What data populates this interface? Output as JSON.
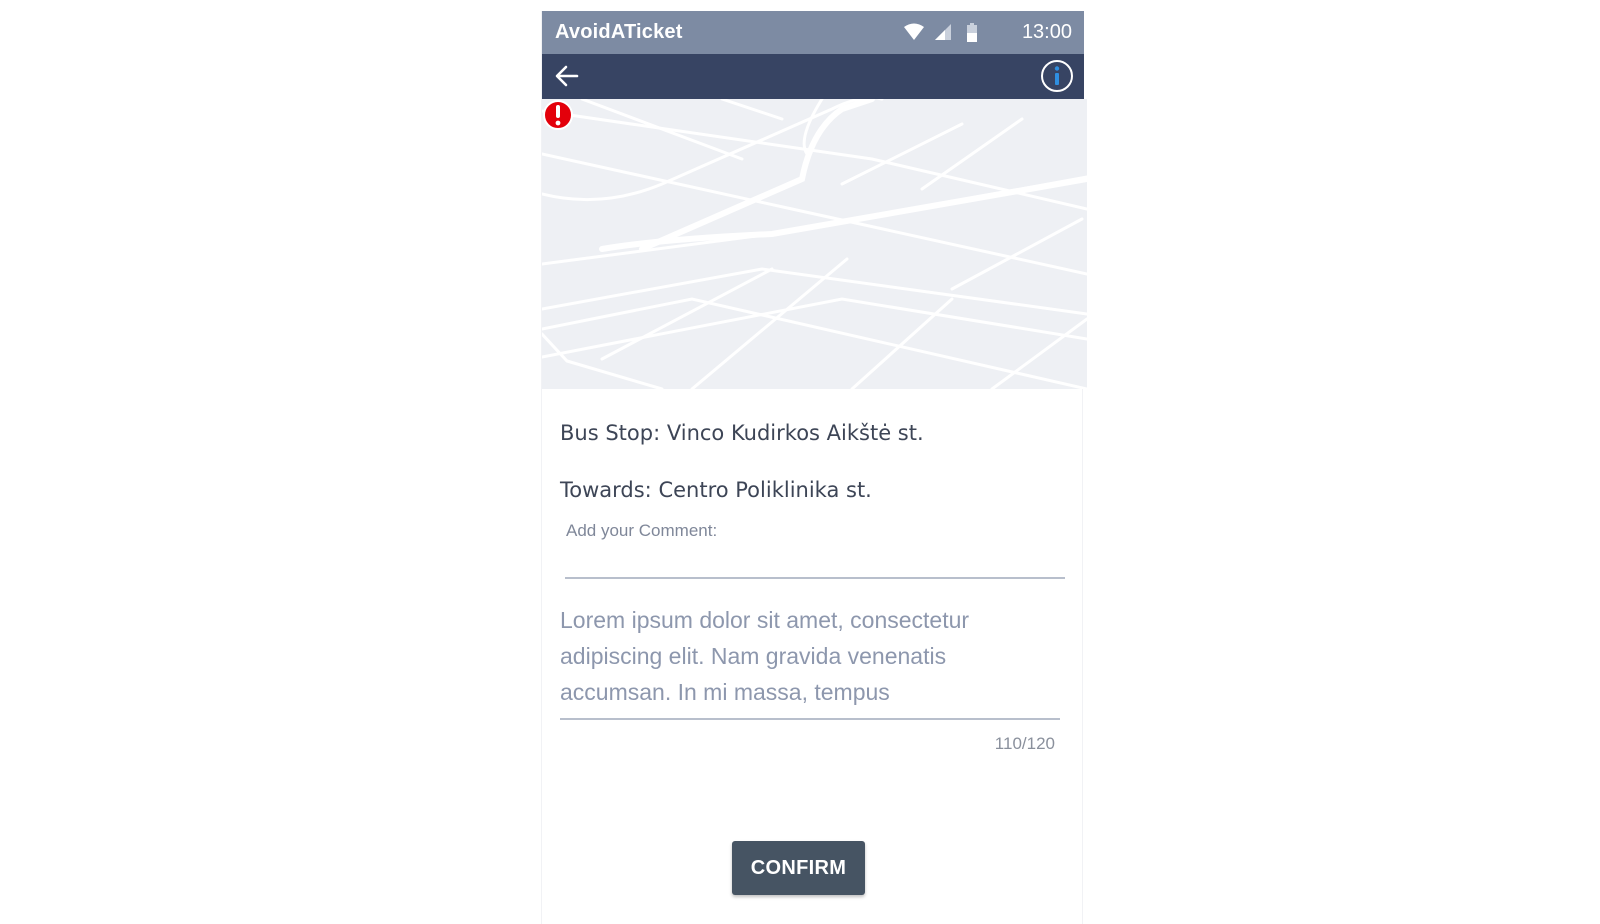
{
  "status_bar": {
    "app_name": "AvoidATicket",
    "time": "13:00",
    "icons": [
      "wifi-icon",
      "signal-icon",
      "battery-icon"
    ],
    "background": "#7d8ba3"
  },
  "app_bar": {
    "background": "#374463",
    "back_icon": "arrow-left-icon",
    "info_icon": "info-icon",
    "info_icon_color": "#2f8fe0"
  },
  "map": {
    "marker_icon": "alert-marker-icon",
    "marker_color": "#e3000b"
  },
  "details": {
    "bus_stop": "Bus Stop: Vinco Kudirkos Aikštė st.",
    "towards": "Towards: Centro Poliklinika st."
  },
  "comment": {
    "label": "Add your Comment:",
    "placeholder": "",
    "text": "Lorem ipsum dolor sit amet, consectetur adipiscing elit. Nam gravida venenatis accumsan. In mi massa, tempus",
    "counter": "110/120"
  },
  "actions": {
    "confirm_label": "CONFIRM"
  }
}
